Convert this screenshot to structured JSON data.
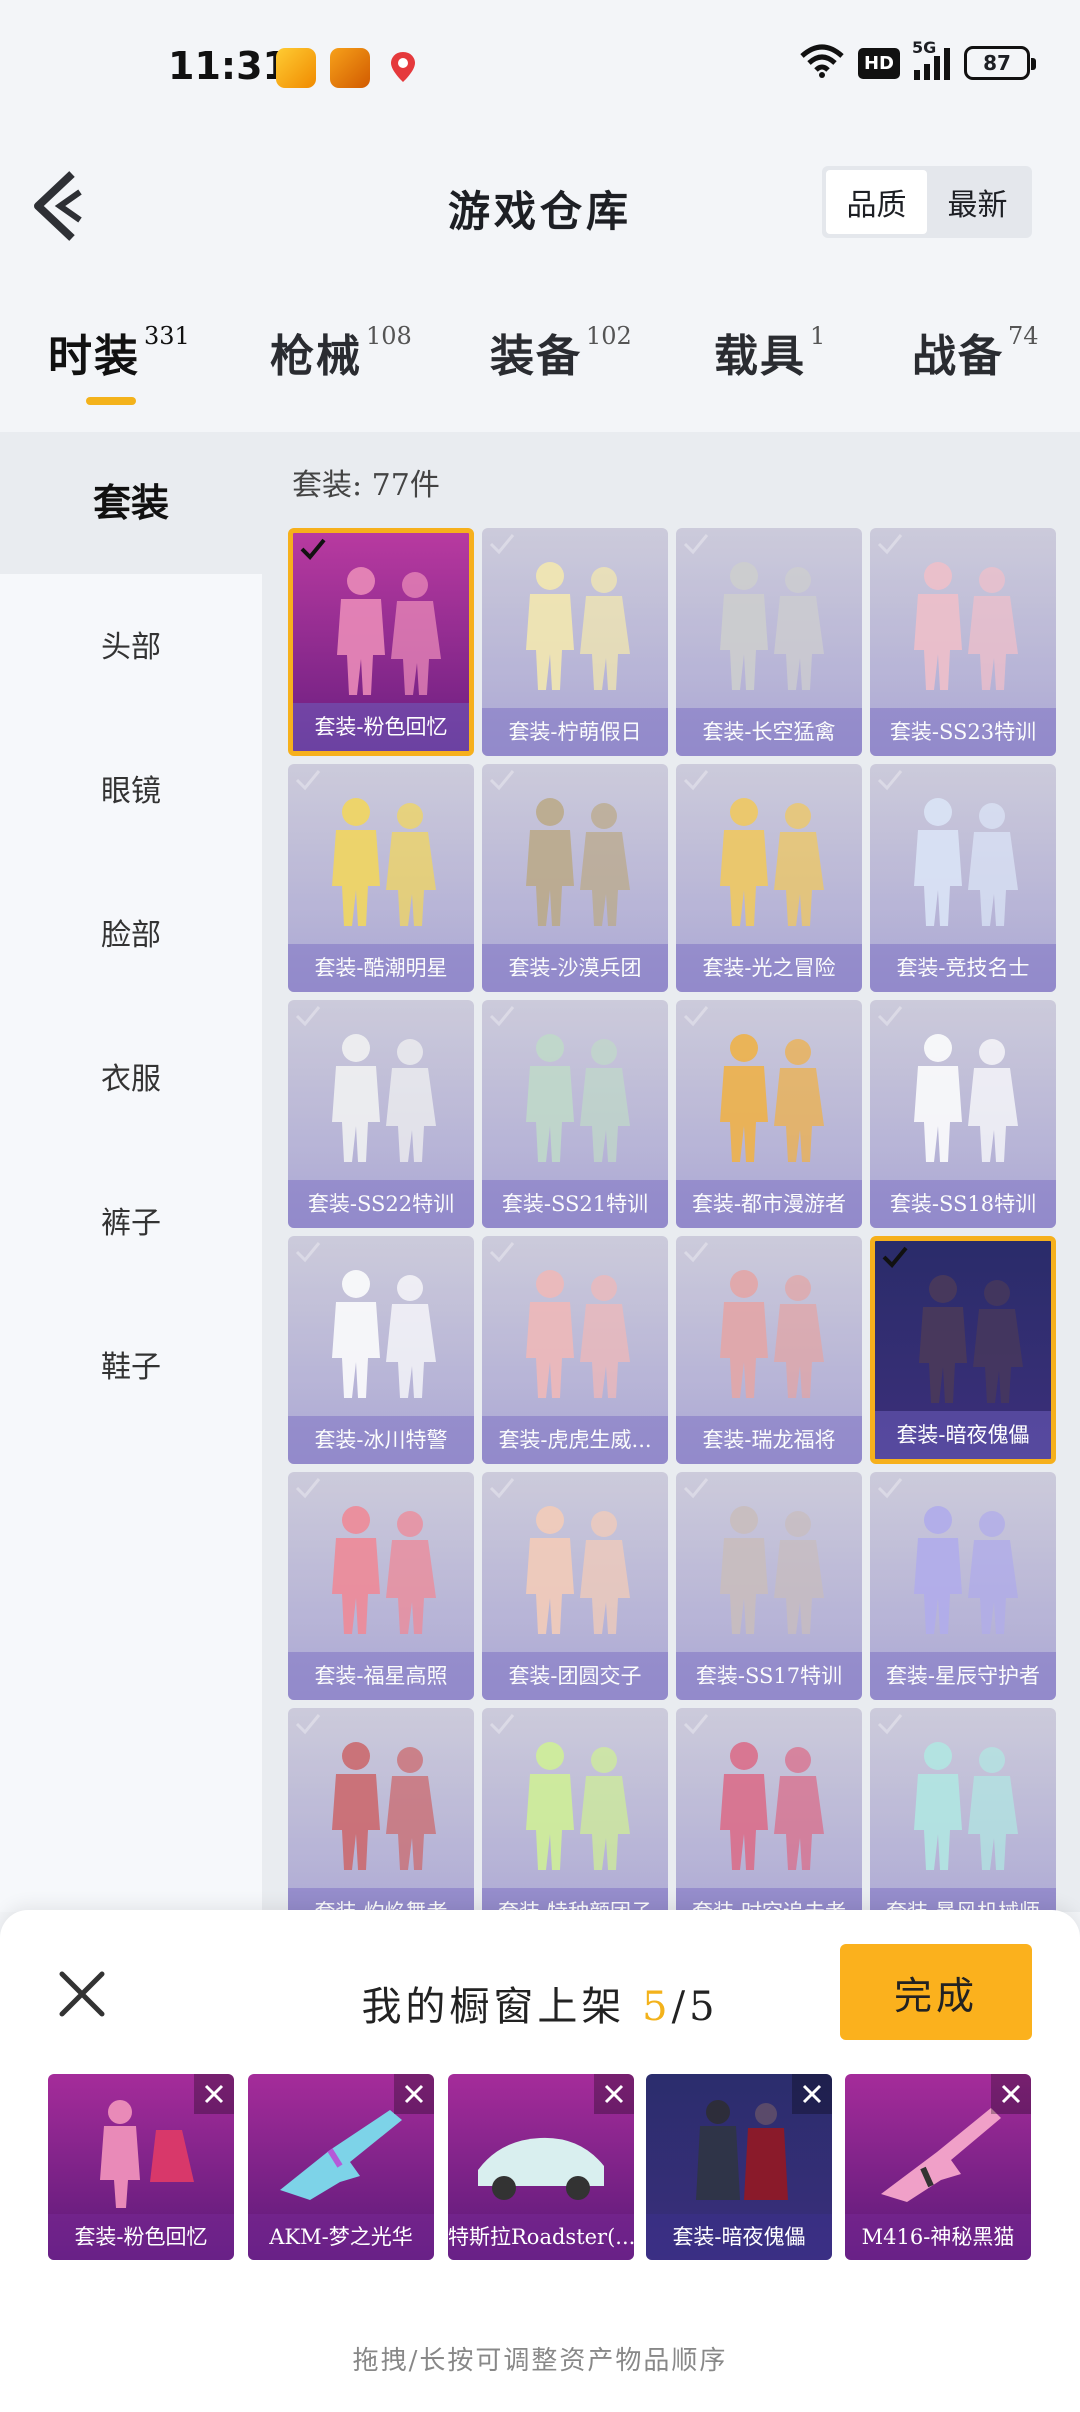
{
  "status": {
    "time": "11:31",
    "network": "5G",
    "hd": "HD",
    "battery": "87"
  },
  "header": {
    "title": "游戏仓库",
    "sort_options": [
      "品质",
      "最新"
    ],
    "sort_selected": "品质"
  },
  "tabs": [
    {
      "label": "时装",
      "count": "331"
    },
    {
      "label": "枪械",
      "count": "108"
    },
    {
      "label": "装备",
      "count": "102"
    },
    {
      "label": "载具",
      "count": "1"
    },
    {
      "label": "战备",
      "count": "74"
    }
  ],
  "sidebar": {
    "items": [
      "套装",
      "头部",
      "眼镜",
      "脸部",
      "衣服",
      "裤子",
      "鞋子"
    ]
  },
  "main": {
    "count_label": "套装: 77件",
    "cards": [
      "套装-粉色回忆",
      "套装-柠萌假日",
      "套装-长空猛禽",
      "套装-SS23特训",
      "套装-酷潮明星",
      "套装-沙漠兵团",
      "套装-光之冒险",
      "套装-竞技名士",
      "套装-SS22特训",
      "套装-SS21特训",
      "套装-都市漫游者",
      "套装-SS18特训",
      "套装-冰川特警",
      "套装-虎虎生威...",
      "套装-瑞龙福将",
      "套装-暗夜傀儡",
      "套装-福星高照",
      "套装-团圆交子",
      "套装-SS17特训",
      "套装-星辰守护者",
      "套装-灼焰舞者",
      "套装-特种颜团子",
      "套装-时空追击者",
      "套装-暴风机械师"
    ]
  },
  "sheet": {
    "title": "我的橱窗上架",
    "current": "5",
    "total": "/5",
    "done_label": "完成",
    "items": [
      "套装-粉色回忆",
      "AKM-梦之光华",
      "特斯拉Roadster(...",
      "套装-暗夜傀儡",
      "M416-神秘黑猫"
    ],
    "hint": "拖拽/长按可调整资产物品顺序"
  },
  "colors": {
    "accent": "#f3b21b",
    "done_button": "#fbb11d"
  }
}
